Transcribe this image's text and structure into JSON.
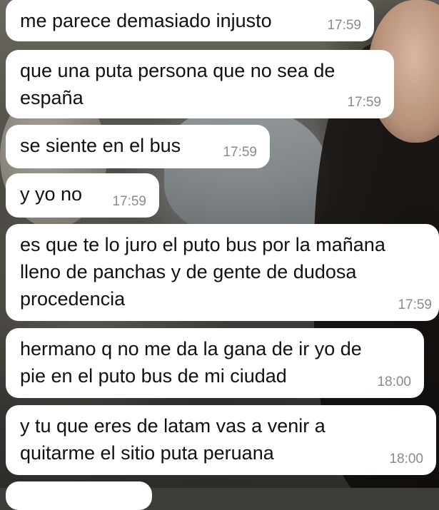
{
  "messages": [
    {
      "text": "me parece demasiado injusto",
      "time": "17:59"
    },
    {
      "text": "que una puta persona que no sea de\nespaña",
      "time": "17:59"
    },
    {
      "text": "se siente en el bus",
      "time": "17:59"
    },
    {
      "text": "y yo no",
      "time": "17:59"
    },
    {
      "text": "es que te lo juro el puto bus por la mañana\nlleno de panchas y de gente de dudosa\nprocedencia",
      "time": "17:59"
    },
    {
      "text": "hermano q no me da la gana de ir yo de\npie en el puto bus de mi ciudad",
      "time": "18:00"
    },
    {
      "text": "y tu que eres de latam vas a venir a\nquitarme el sitio puta peruana",
      "time": "18:00"
    }
  ],
  "colors": {
    "bubble_background": "#ffffff",
    "message_text": "#111111",
    "timestamp_text": "#8a8a8e"
  }
}
